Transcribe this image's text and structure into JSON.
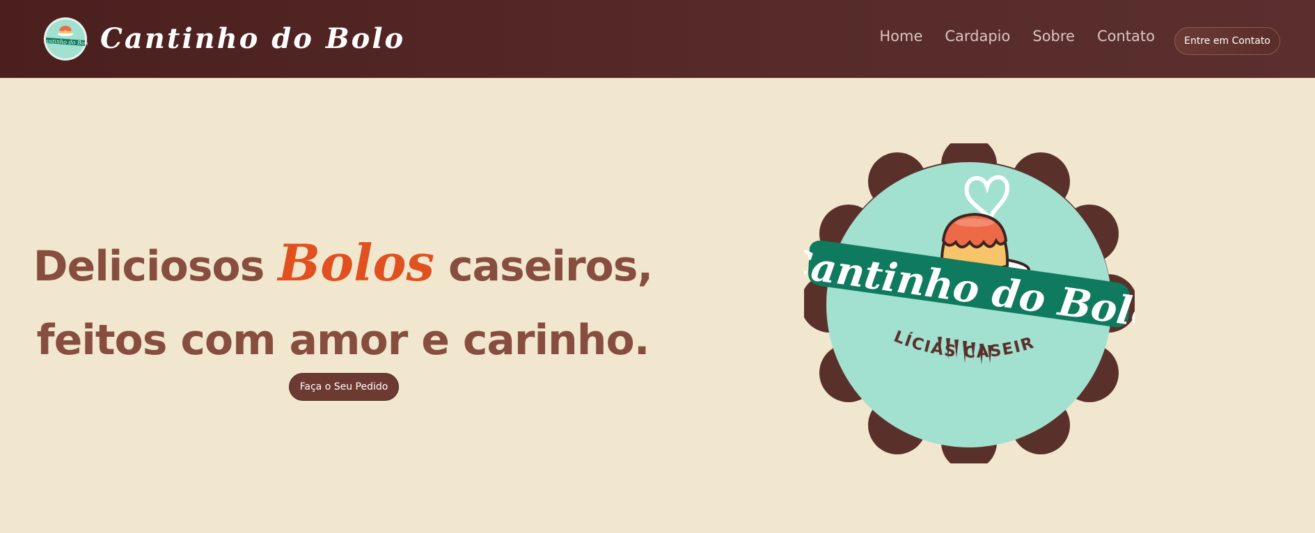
{
  "header": {
    "brand_name": "Cantinho do Bolo",
    "nav": [
      {
        "label": "Home"
      },
      {
        "label": "Cardapio"
      },
      {
        "label": "Sobre"
      },
      {
        "label": "Contato"
      }
    ],
    "contact_button": "Entre em Contato"
  },
  "hero": {
    "title_part1": "Deliciosos",
    "title_accent": "Bolos",
    "title_part2": "caseiros,",
    "title_line2": "feitos com amor e carinho.",
    "order_button": "Faça o Seu Pedido"
  },
  "logo": {
    "name": "Cantinho do Bolo",
    "tagline": "DELÍCIAS CASEIRAS"
  },
  "colors": {
    "header_bg": "#4b1f1e",
    "page_bg": "#f1e7cf",
    "title_brown": "#874e40",
    "accent_orange": "#e0511f",
    "logo_mint": "#a2e0cf",
    "logo_green": "#0f7a5e",
    "logo_border": "#5a302b"
  }
}
